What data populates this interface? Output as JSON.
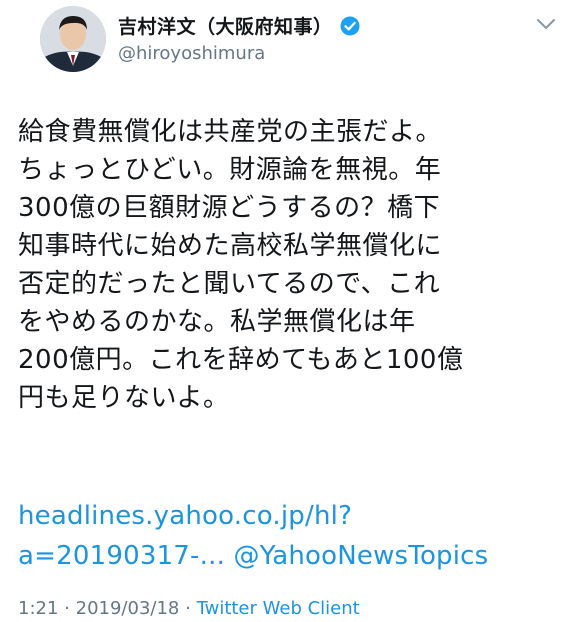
{
  "tweet": {
    "display_name": "吉村洋文（大阪府知事）",
    "handle": "@hiroyoshimura",
    "verified_icon": "verified-badge-icon",
    "menu_icon": "chevron-down-icon",
    "text_lines": [
      "給食費無償化は共産党の主張だよ。",
      "ちょっとひどい。財源論を無視。年",
      "300億の巨額財源どうするの？橋下",
      "知事時代に始めた高校私学無償化に",
      "否定的だったと聞いてるので、これ",
      "をやめるのかな。私学無償化は年",
      "200億円。これを辞めてもあと100億",
      "円も足りないよ。"
    ],
    "link_lines": [
      "headlines.yahoo.co.jp/hl?",
      "a=20190317-... @YahooNewsTopics"
    ],
    "time": "1:21",
    "date": "2019/03/18",
    "separator": "·",
    "client": "Twitter Web Client",
    "colors": {
      "link": "#1b95e0",
      "secondary": "#657786",
      "verified": "#1da1f2"
    }
  }
}
